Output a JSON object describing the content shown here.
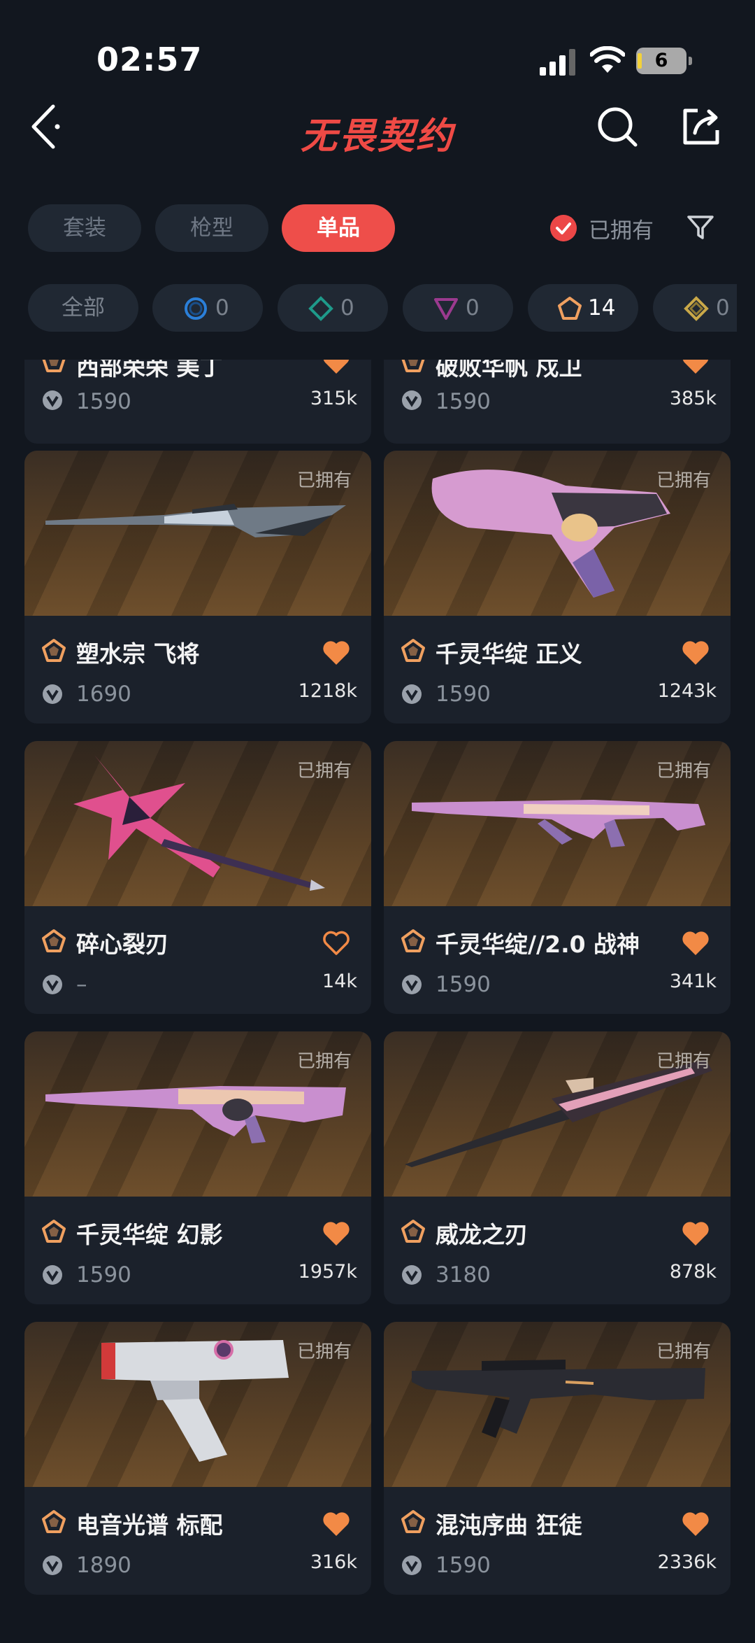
{
  "status": {
    "time": "02:57",
    "battery": "6"
  },
  "header": {
    "title": "无畏契约"
  },
  "tabs": [
    {
      "label": "套装",
      "active": false
    },
    {
      "label": "枪型",
      "active": false
    },
    {
      "label": "单品",
      "active": true
    }
  ],
  "owned_filter": {
    "label": "已拥有",
    "checked": true
  },
  "rarity_filters": [
    {
      "label": "全部"
    },
    {
      "icon": "circle-rarity-icon",
      "count": "0",
      "color": "#2b7fd8"
    },
    {
      "icon": "diamond-rarity-icon",
      "count": "0",
      "color": "#1e9a8a"
    },
    {
      "icon": "triangle-rarity-icon",
      "count": "0",
      "color": "#9b3a8f"
    },
    {
      "icon": "pentagon-rarity-icon",
      "count": "14",
      "color": "#f0a060"
    },
    {
      "icon": "diamond-gold-rarity-icon",
      "count": "0",
      "color": "#c9a848"
    }
  ],
  "items": [
    {
      "name": "西部荣荣 美丁",
      "price": "1590",
      "likes": "315k",
      "owned": "",
      "liked": true
    },
    {
      "name": "破败华帆 戍卫",
      "price": "1590",
      "likes": "385k",
      "owned": "",
      "liked": true
    },
    {
      "name": "塑水宗 飞将",
      "price": "1690",
      "likes": "1218k",
      "owned": "已拥有",
      "liked": true
    },
    {
      "name": "千灵华绽 正义",
      "price": "1590",
      "likes": "1243k",
      "owned": "已拥有",
      "liked": true
    },
    {
      "name": "碎心裂刃",
      "price": "–",
      "likes": "14k",
      "owned": "已拥有",
      "liked": false
    },
    {
      "name": "千灵华绽//2.0 战神",
      "price": "1590",
      "likes": "341k",
      "owned": "已拥有",
      "liked": true
    },
    {
      "name": "千灵华绽 幻影",
      "price": "1590",
      "likes": "1957k",
      "owned": "已拥有",
      "liked": true
    },
    {
      "name": "威龙之刃",
      "price": "3180",
      "likes": "878k",
      "owned": "已拥有",
      "liked": true
    },
    {
      "name": "电音光谱 标配",
      "price": "1890",
      "likes": "316k",
      "owned": "已拥有",
      "liked": true
    },
    {
      "name": "混沌序曲 狂徒",
      "price": "1590",
      "likes": "2336k",
      "owned": "已拥有",
      "liked": true
    }
  ],
  "colors": {
    "accent": "#ee4e4a",
    "heart": "#f28a46",
    "background": "#12171f"
  }
}
